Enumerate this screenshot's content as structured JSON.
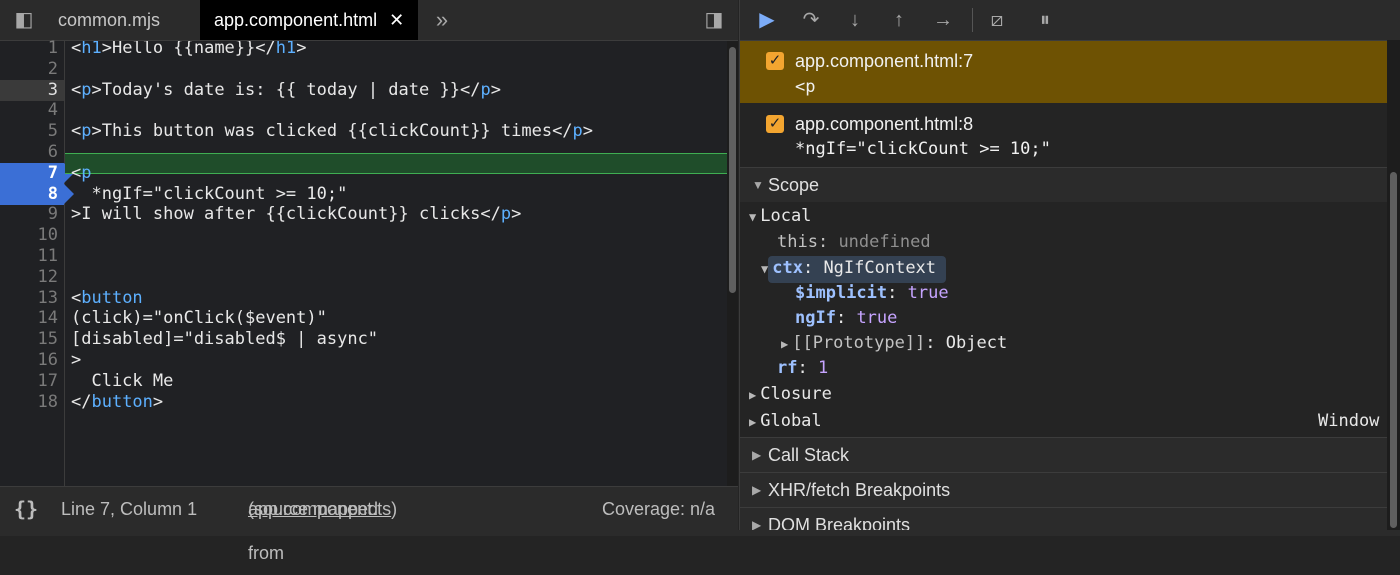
{
  "editor": {
    "tabs": [
      {
        "label": "common.mjs"
      },
      {
        "label": "app.component.html",
        "close": "✕"
      }
    ],
    "more_tabs": "»",
    "lines": [
      {
        "n": "1",
        "text": "<h1>Hello {{name}}</h1>"
      },
      {
        "n": "2",
        "text": ""
      },
      {
        "n": "3",
        "text": "<p>Today's date is: {{ today | date }}</p>"
      },
      {
        "n": "4",
        "text": ""
      },
      {
        "n": "5",
        "text": "<p>This button was clicked {{clickCount}} times</p>"
      },
      {
        "n": "6",
        "text": ""
      },
      {
        "n": "7",
        "text": "<p"
      },
      {
        "n": "8",
        "text": "  *ngIf=\"clickCount >= 10;\""
      },
      {
        "n": "9",
        "text": ">I will show after {{clickCount}} clicks</p>"
      },
      {
        "n": "10",
        "text": ""
      },
      {
        "n": "11",
        "text": ""
      },
      {
        "n": "12",
        "text": ""
      },
      {
        "n": "13",
        "text": "<button"
      },
      {
        "n": "14",
        "text": "(click)=\"onClick($event)\""
      },
      {
        "n": "15",
        "text": "[disabled]=\"disabled$ | async\""
      },
      {
        "n": "16",
        "text": ">"
      },
      {
        "n": "17",
        "text": "  Click Me"
      },
      {
        "n": "18",
        "text": "</button>"
      }
    ],
    "status": {
      "braces": "{}",
      "position": "Line 7, Column 1",
      "source_prefix": "(source mapped from ",
      "source_link": "app.component.ts",
      "source_suffix": ")",
      "coverage": "Coverage: n/a"
    }
  },
  "breakpoints": [
    {
      "file": "app.component.html:7",
      "code": "<p",
      "checked": "✓"
    },
    {
      "file": "app.component.html:8",
      "code": "*ngIf=\"clickCount >= 10;\"",
      "checked": "✓"
    }
  ],
  "scope": {
    "title": "Scope",
    "local": "Local",
    "this_key": "this",
    "this_val": "undefined",
    "ctx_key": "ctx",
    "ctx_val": "NgIfContext",
    "implicit_key": "$implicit",
    "implicit_val": "true",
    "ngif_key": "ngIf",
    "ngif_val": "true",
    "proto_key": "[[Prototype]]",
    "proto_val": "Object",
    "rf_key": "rf",
    "rf_val": "1",
    "closure": "Closure",
    "global": "Global",
    "global_val": "Window"
  },
  "sections": [
    {
      "label": "Call Stack"
    },
    {
      "label": "XHR/fetch Breakpoints"
    },
    {
      "label": "DOM Breakpoints"
    }
  ],
  "colors": {
    "accent_blue": "#3b6fd6",
    "paused_yellow": "#6e5203",
    "exec_line_green": "#1f4d2a"
  }
}
